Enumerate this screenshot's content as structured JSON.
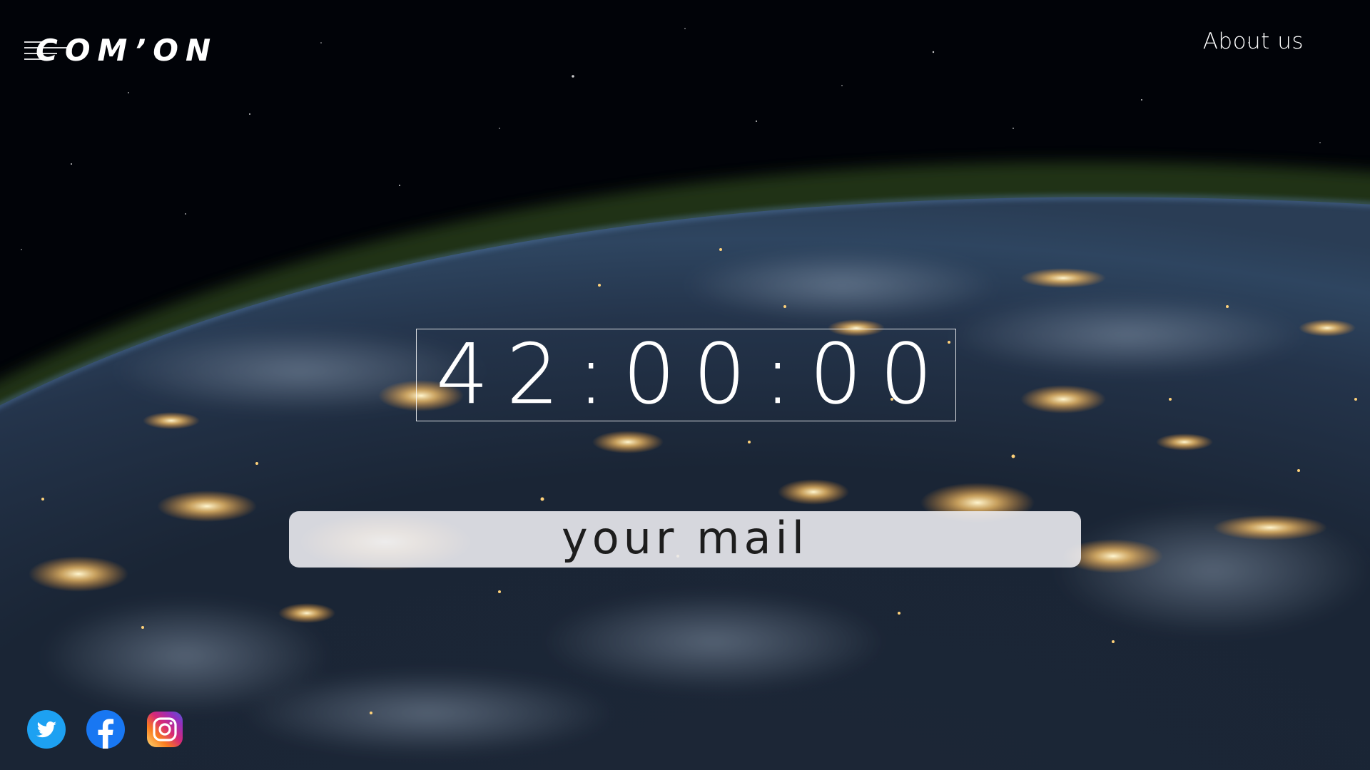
{
  "header": {
    "logo_text": "COM’ON",
    "about_label": "About us"
  },
  "countdown": {
    "value": "42:00:00"
  },
  "signup": {
    "placeholder": "your mail"
  },
  "social": {
    "items": [
      {
        "icon": "twitter-icon",
        "color": "#1da1f2"
      },
      {
        "icon": "facebook-icon",
        "color": "#1877f2"
      },
      {
        "icon": "instagram-icon",
        "color": "#e1306c"
      }
    ]
  }
}
